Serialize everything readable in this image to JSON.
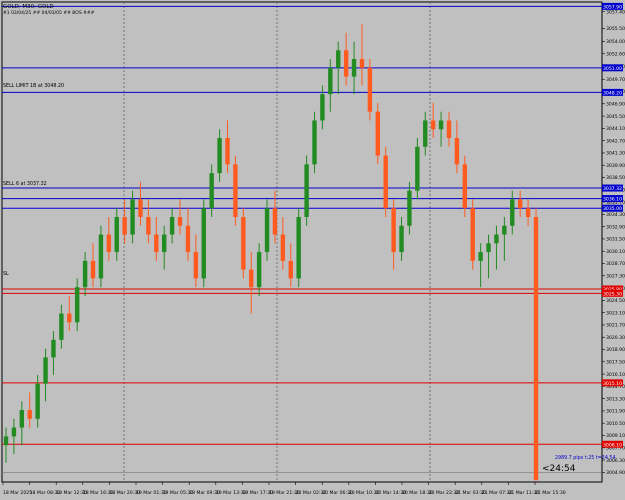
{
  "header": {
    "symbol_line": "GOLD, M30: GOLD",
    "info_line": "#1 03/04/25 ## 04/03/05 ## BOS ###"
  },
  "orders": {
    "sell_limit_label": "SELL LIMIT 1B at 3048.20",
    "sell_label": "SELL 6 at 3037.32",
    "sl_label": "SL"
  },
  "timer": {
    "text": "<24:54"
  },
  "spread_note": {
    "text": "2989.7 pips t:25 t=24.54"
  },
  "colors": {
    "background": "#c0c0c0",
    "bull": "#228b22",
    "bear": "#ff5a1f",
    "blue_line": "#0000cd",
    "red_line": "#e00000",
    "grid": "#555555"
  },
  "chart_data": {
    "type": "candlestick",
    "symbol": "GOLD",
    "timeframe": "M30",
    "ylim": [
      3003.8,
      3058.5
    ],
    "y_ticks": [
      "3057.40",
      "3055.50",
      "3054.00",
      "3052.60",
      "3051.20",
      "3049.70",
      "3048.30",
      "3046.90",
      "3045.50",
      "3044.10",
      "3042.70",
      "3041.30",
      "3039.90",
      "3038.50",
      "3037.10",
      "3035.70",
      "3034.30",
      "3032.90",
      "3031.50",
      "3030.10",
      "3028.70",
      "3027.30",
      "3025.90",
      "3024.50",
      "3023.10",
      "3021.70",
      "3020.30",
      "3018.90",
      "3017.50",
      "3016.10",
      "3014.70",
      "3013.30",
      "3011.90",
      "3010.50",
      "3009.10",
      "3007.70",
      "3006.30",
      "3004.90"
    ],
    "x_ticks": [
      "18 Mar 2025",
      "18 Mar 08:30",
      "18 Mar 12:30",
      "18 Mar 16:30",
      "18 Mar 20:30",
      "19 Mar 01:30",
      "19 Mar 05:30",
      "19 Mar 09:30",
      "19 Mar 13:30",
      "19 Mar 17:30",
      "19 Mar 21:30",
      "20 Mar 02:30",
      "20 Mar 06:30",
      "20 Mar 10:30",
      "20 Mar 14:30",
      "20 Mar 18:30",
      "20 Mar 22:30",
      "21 Mar 03:30",
      "21 Mar 07:30",
      "21 Mar 11:30",
      "21 Mar 15:30"
    ],
    "levels": [
      {
        "price": 3058.0,
        "color": "blue",
        "tag": "3057.90"
      },
      {
        "price": 3051.0,
        "color": "blue",
        "tag": "3051.00"
      },
      {
        "price": 3048.2,
        "color": "blue",
        "tag": "3048.20"
      },
      {
        "price": 3037.3,
        "color": "blue",
        "tag": "3037.32"
      },
      {
        "price": 3036.1,
        "color": "blue",
        "tag": "3036.10"
      },
      {
        "price": 3035.0,
        "color": "blue",
        "tag": "3035.00"
      },
      {
        "price": 3025.8,
        "color": "red",
        "tag": "3025.80"
      },
      {
        "price": 3025.3,
        "color": "red",
        "tag": "3025.30"
      },
      {
        "price": 3015.1,
        "color": "red",
        "tag": "3015.10"
      },
      {
        "price": 3008.1,
        "color": "red",
        "tag": "3008.10"
      }
    ],
    "candles": [
      [
        3008,
        3010,
        3006,
        3009
      ],
      [
        3009,
        3011,
        3007,
        3010
      ],
      [
        3010,
        3013,
        3008,
        3012
      ],
      [
        3012,
        3014,
        3010,
        3011
      ],
      [
        3011,
        3016,
        3010,
        3015
      ],
      [
        3015,
        3019,
        3013,
        3018
      ],
      [
        3018,
        3021,
        3016,
        3020
      ],
      [
        3020,
        3024,
        3019,
        3023
      ],
      [
        3023,
        3025,
        3021,
        3022
      ],
      [
        3022,
        3027,
        3021,
        3026
      ],
      [
        3026,
        3030,
        3025,
        3029
      ],
      [
        3029,
        3031,
        3026,
        3027
      ],
      [
        3027,
        3033,
        3026,
        3032
      ],
      [
        3032,
        3034,
        3029,
        3030
      ],
      [
        3030,
        3035,
        3029,
        3034
      ],
      [
        3034,
        3036,
        3031,
        3032
      ],
      [
        3032,
        3037,
        3031,
        3036
      ],
      [
        3036,
        3038,
        3033,
        3034
      ],
      [
        3034,
        3036,
        3031,
        3032
      ],
      [
        3032,
        3034,
        3029,
        3030
      ],
      [
        3030,
        3033,
        3028,
        3032
      ],
      [
        3032,
        3035,
        3031,
        3034
      ],
      [
        3034,
        3036,
        3032,
        3033
      ],
      [
        3033,
        3035,
        3029,
        3030
      ],
      [
        3030,
        3032,
        3026,
        3027
      ],
      [
        3027,
        3036,
        3026,
        3035
      ],
      [
        3035,
        3040,
        3034,
        3039
      ],
      [
        3039,
        3044,
        3038,
        3043
      ],
      [
        3043,
        3045,
        3039,
        3040
      ],
      [
        3040,
        3041,
        3033,
        3034
      ],
      [
        3034,
        3035,
        3027,
        3028
      ],
      [
        3028,
        3030,
        3023,
        3026
      ],
      [
        3026,
        3031,
        3025,
        3030
      ],
      [
        3030,
        3036,
        3029,
        3035
      ],
      [
        3035,
        3037,
        3031,
        3032
      ],
      [
        3032,
        3034,
        3028,
        3029
      ],
      [
        3029,
        3031,
        3026,
        3027
      ],
      [
        3027,
        3035,
        3026,
        3034
      ],
      [
        3034,
        3041,
        3033,
        3040
      ],
      [
        3040,
        3046,
        3039,
        3045
      ],
      [
        3045,
        3049,
        3044,
        3048
      ],
      [
        3048,
        3052,
        3046,
        3051
      ],
      [
        3051,
        3054,
        3048,
        3053
      ],
      [
        3053,
        3055,
        3049,
        3050
      ],
      [
        3050,
        3054,
        3048,
        3052
      ],
      [
        3052,
        3056,
        3049,
        3051
      ],
      [
        3051,
        3052,
        3045,
        3046
      ],
      [
        3046,
        3047,
        3040,
        3041
      ],
      [
        3041,
        3042,
        3034,
        3035
      ],
      [
        3035,
        3036,
        3028,
        3030
      ],
      [
        3030,
        3034,
        3029,
        3033
      ],
      [
        3033,
        3038,
        3032,
        3037
      ],
      [
        3037,
        3043,
        3036,
        3042
      ],
      [
        3042,
        3046,
        3041,
        3045
      ],
      [
        3045,
        3047,
        3043,
        3044
      ],
      [
        3044,
        3046,
        3042,
        3045
      ],
      [
        3045,
        3046,
        3042,
        3043
      ],
      [
        3043,
        3045,
        3039,
        3040
      ],
      [
        3040,
        3041,
        3034,
        3035
      ],
      [
        3035,
        3036,
        3028,
        3029
      ],
      [
        3029,
        3031,
        3026,
        3030
      ],
      [
        3030,
        3032,
        3027,
        3031
      ],
      [
        3031,
        3033,
        3028,
        3032
      ],
      [
        3032,
        3034,
        3029,
        3033
      ],
      [
        3033,
        3037,
        3032,
        3036
      ],
      [
        3036,
        3037,
        3034,
        3035
      ],
      [
        3035,
        3036,
        3033,
        3034
      ],
      [
        3034,
        3035,
        3023,
        3004
      ]
    ]
  }
}
